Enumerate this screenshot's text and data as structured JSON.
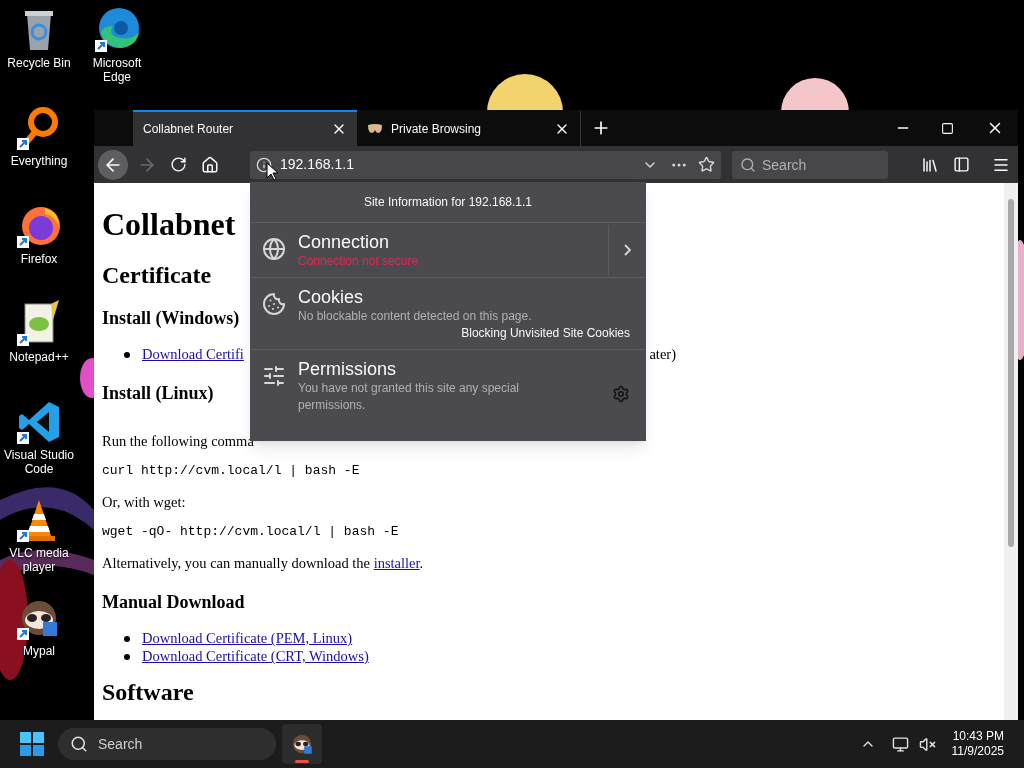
{
  "desktop": {
    "columns": [
      [
        {
          "label": "Recycle Bin"
        },
        {
          "label": "Everything"
        },
        {
          "label": "Firefox"
        },
        {
          "label": "Notepad++"
        },
        {
          "label": "Visual Studio Code"
        },
        {
          "label": "VLC media player"
        },
        {
          "label": "Mypal"
        }
      ],
      [
        {
          "label": "Microsoft Edge"
        }
      ]
    ]
  },
  "browser": {
    "tabs": [
      {
        "title": "Collabnet Router",
        "selected": true
      },
      {
        "title": "Private Browsing",
        "selected": false
      }
    ],
    "back": {
      "disabled": false
    },
    "forward": {
      "disabled": true
    },
    "address": "192.168.1.1",
    "search": {
      "placeholder": "Search"
    },
    "page": {
      "blocks": [
        {
          "kind": "h1",
          "text": "Collabnet"
        },
        {
          "kind": "h2",
          "text": "Certificate"
        },
        {
          "kind": "h3",
          "text": "Install (Windows)"
        },
        {
          "kind": "list",
          "items": [
            {
              "link": "Download Certifi",
              "after": "ater)"
            }
          ]
        },
        {
          "kind": "h3",
          "text": "Install (Linux)"
        },
        {
          "kind": "p",
          "text": "Run the following comma"
        },
        {
          "kind": "code",
          "text": "curl http://cvm.local/l | bash -E"
        },
        {
          "kind": "p",
          "text": "Or, with wget:"
        },
        {
          "kind": "code",
          "text": "wget -qO- http://cvm.local/l | bash -E"
        },
        {
          "kind": "p",
          "text": "Alternatively, you can manually download the ",
          "link": "installer",
          "after": "."
        },
        {
          "kind": "h3",
          "text": "Manual Download"
        },
        {
          "kind": "list",
          "items": [
            {
              "link": "Download Certificate (PEM, Linux)"
            },
            {
              "link": "Download Certificate (CRT, Windows)"
            }
          ]
        },
        {
          "kind": "h2",
          "text": "Software"
        }
      ]
    },
    "popup": {
      "title": "Site Information for 192.168.1.1",
      "sections": [
        {
          "kind": "connection",
          "title": "Connection",
          "status": "Connection not secure",
          "secure": false
        },
        {
          "kind": "cookies",
          "title": "Cookies",
          "description": "No blockable content detected on this page.",
          "note": "Blocking Unvisited Site Cookies"
        },
        {
          "kind": "permissions",
          "title": "Permissions",
          "description": "You have not granted this site any special permissions."
        }
      ]
    }
  },
  "taskbar": {
    "search": {
      "placeholder": "Search"
    },
    "apps": [
      {
        "active": true
      }
    ],
    "clock": {
      "time": "10:43 PM",
      "date": "11/9/2025"
    }
  }
}
